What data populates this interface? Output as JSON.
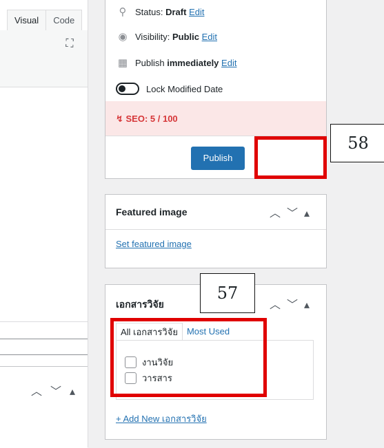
{
  "editor": {
    "tabs": [
      "Visual",
      "Code"
    ],
    "expand_icon": "fullscreen-icon"
  },
  "publish_box": {
    "status_label": "Status:",
    "status_value": "Draft",
    "status_edit": "Edit",
    "visibility_label": "Visibility:",
    "visibility_value": "Public",
    "visibility_edit": "Edit",
    "publish_label": "Publish",
    "publish_value": "immediately",
    "publish_edit": "Edit",
    "lock_label": "Lock Modified Date",
    "seo_label": "SEO: 5 / 100",
    "publish_button": "Publish"
  },
  "featured_image": {
    "title": "Featured image",
    "link": "Set featured image"
  },
  "research_documents": {
    "title": "เอกสารวิจัย",
    "tabs": [
      "All เอกสารวิจัย",
      "Most Used"
    ],
    "items": [
      "งานวิจัย",
      "วารสาร"
    ],
    "add_link": "+ Add New เอกสารวิจัย"
  },
  "annotations": {
    "publish_callout": "58",
    "taxonomy_callout": "57",
    "highlight_color": "#e00000"
  },
  "colors": {
    "primary": "#2271b1",
    "seo_bg": "#fbe7e7",
    "seo_text": "#d63638"
  }
}
